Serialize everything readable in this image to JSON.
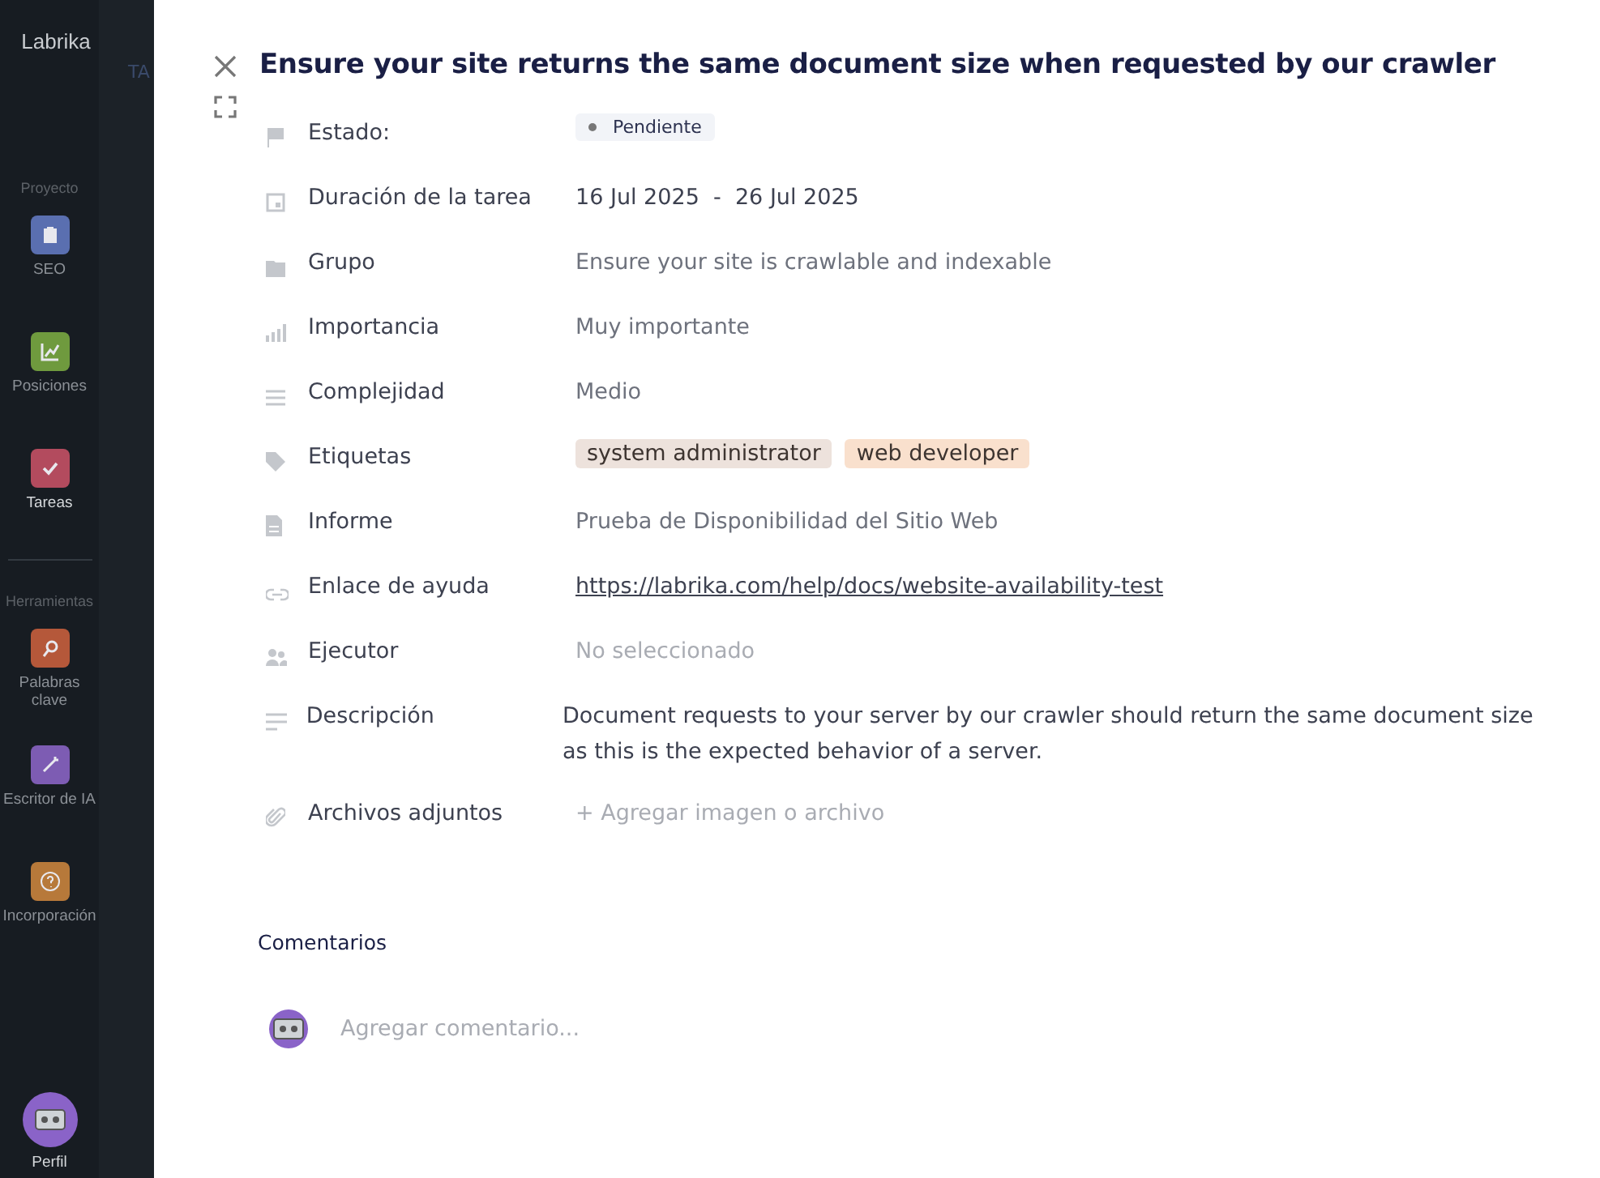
{
  "sidebar": {
    "logo": "Labrika",
    "panel_label": "TA",
    "sections": [
      {
        "title": "Proyecto",
        "items": [
          {
            "label": "SEO",
            "color": "#5a6fb0",
            "selected": false
          },
          {
            "label": "Posiciones",
            "color": "#6f9a3e",
            "selected": false
          },
          {
            "label": "Tareas",
            "color": "#b34b5e",
            "selected": true
          }
        ]
      },
      {
        "title": "Herramientas",
        "items": [
          {
            "label": "Palabras clave",
            "color": "#b5583a",
            "selected": false
          },
          {
            "label": "Escritor de IA",
            "color": "#7d5cb3",
            "selected": false
          },
          {
            "label": "Incorporación",
            "color": "#b7793a",
            "selected": false
          }
        ]
      }
    ],
    "profile": "Perfil"
  },
  "task": {
    "title": "Ensure your site returns the same document size when requested by our crawler",
    "fields": [
      {
        "kind": "status",
        "label": "Estado:",
        "value": "Pendiente"
      },
      {
        "kind": "dates",
        "label": "Duración de la tarea",
        "start": "16 Jul 2025",
        "separator": "-",
        "end": "26 Jul 2025"
      },
      {
        "kind": "text",
        "label": "Grupo",
        "value": "Ensure your site is crawlable and indexable"
      },
      {
        "kind": "text",
        "label": "Importancia",
        "value": "Muy importante"
      },
      {
        "kind": "text",
        "label": "Complejidad",
        "value": "Medio"
      },
      {
        "kind": "tags",
        "label": "Etiquetas",
        "tags": [
          {
            "label": "system administrator",
            "color": "#ede2dc"
          },
          {
            "label": "web developer",
            "color": "#f9e0cd"
          }
        ]
      },
      {
        "kind": "text",
        "label": "Informe",
        "value": "Prueba de Disponibilidad del Sitio Web"
      },
      {
        "kind": "link",
        "label": "Enlace de ayuda",
        "value": "https://labrika.com/help/docs/website-availability-test"
      },
      {
        "kind": "muted",
        "label": "Ejecutor",
        "value": "No seleccionado"
      },
      {
        "kind": "paragraph",
        "label": "Descripción",
        "value": "Document requests to your server by our crawler should return the same document size as this is the expected behavior of a server."
      },
      {
        "kind": "muted",
        "label": "Archivos adjuntos",
        "value": "+ Agregar imagen o archivo"
      }
    ],
    "comments": {
      "title": "Comentarios",
      "placeholder": "Agregar comentario..."
    }
  }
}
